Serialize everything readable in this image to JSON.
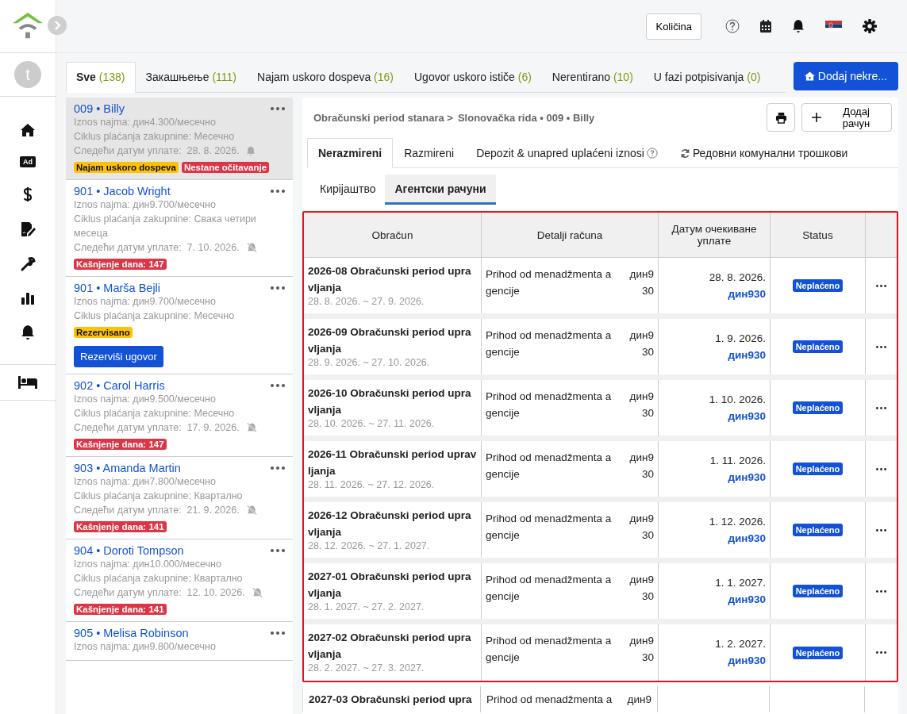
{
  "header": {
    "quantity_button": "Količina"
  },
  "avatar": {
    "letter": "t"
  },
  "rail": {
    "items": [
      {
        "kind": "home"
      },
      {
        "kind": "ad",
        "label": "Ad"
      },
      {
        "kind": "dollar"
      },
      {
        "kind": "contract"
      },
      {
        "kind": "wrench"
      },
      {
        "kind": "chart"
      },
      {
        "kind": "bell"
      },
      {
        "kind": "bed"
      }
    ]
  },
  "filter_tabs": [
    {
      "label": "Sve",
      "count": "(138)",
      "selected": true
    },
    {
      "label": "Закашњење",
      "count": "(111)",
      "selected": false
    },
    {
      "label": "Najam uskoro dospeva",
      "count": "(16)",
      "selected": false
    },
    {
      "label": "Ugovor uskoro ističe",
      "count": "(6)",
      "selected": false
    },
    {
      "label": "Nerentirano",
      "count": "(10)",
      "selected": false
    },
    {
      "label": "U fazi potpisivanja",
      "count": "(0)",
      "selected": false
    }
  ],
  "add_property_button": "Dodaj nekre...",
  "unit_separator": "•",
  "units": [
    {
      "number": "009",
      "name": "Billy",
      "rent": "Iznos najma: дин4.300/месечно",
      "cycle": "Ciklus plaćanja zakupnine: Месечно",
      "next_label": "Следећи датум уплате:",
      "next_date": "28. 8. 2026.",
      "reminder": true,
      "selected": true,
      "tags": [
        {
          "label": "Najam uskoro dospeva",
          "color": "#ffc107"
        },
        {
          "label": "Nestane očitavanje",
          "color": "#dc3545"
        }
      ]
    },
    {
      "number": "901",
      "name": "Jacob Wright",
      "rent": "Iznos najma: дин9.700/месечно",
      "cycle": "Ciklus plaćanja zakupnine: Свака четири месеца",
      "next_label": "Следећи датум уплате:",
      "next_date": "7. 10. 2026.",
      "reminder": false,
      "selected": false,
      "tags": [
        {
          "label": "Kašnjenje dana: 147",
          "color": "#dc3545"
        }
      ]
    },
    {
      "number": "901",
      "name": "Marša Bejli",
      "rent": "Iznos najma: дин9.700/месечно",
      "cycle": "Ciklus plaćanja zakupnine: Месечно",
      "selected": false,
      "tags": [
        {
          "label": "Rezervisano",
          "color": "#ffc107"
        }
      ],
      "button": "Rezerviši ugovor"
    },
    {
      "number": "902",
      "name": "Carol Harris",
      "rent": "Iznos najma: дин9.500/месечно",
      "cycle": "Ciklus plaćanja zakupnine: Месечно",
      "next_label": "Следећи датум уплате:",
      "next_date": "17. 9. 2026.",
      "reminder": false,
      "selected": false,
      "tags": [
        {
          "label": "Kašnjenje dana: 147",
          "color": "#dc3545"
        }
      ]
    },
    {
      "number": "903",
      "name": "Amanda Martin",
      "rent": "Iznos najma: дин7.800/месечно",
      "cycle": "Ciklus plaćanja zakupnine: Квартално",
      "next_label": "Следећи датум уплате:",
      "next_date": "21. 9. 2026.",
      "reminder": false,
      "selected": false,
      "tags": [
        {
          "label": "Kašnjenje dana: 141",
          "color": "#dc3545"
        }
      ]
    },
    {
      "number": "904",
      "name": "Doroti Tompson",
      "rent": "Iznos najma: дин10.000/месечно",
      "cycle": "Ciklus plaćanja zakupnine: Квартално",
      "next_label": "Следећи датум уплате:",
      "next_date": "12. 10. 2026.",
      "reminder": false,
      "selected": false,
      "tags": [
        {
          "label": "Kašnjenje dana: 141",
          "color": "#dc3545"
        }
      ]
    },
    {
      "number": "905",
      "name": "Melisa Robinson",
      "rent": "Iznos najma: дин9.800/месечно",
      "selected": false
    }
  ],
  "breadcrumb": [
    "Obračunski period stanara >",
    "Slonovačka rida • 009 • Billy"
  ],
  "add_bill_button": "Додај рачун",
  "detail_tabs": [
    {
      "label": "Nerazmireni",
      "kind": "plain",
      "selected": true
    },
    {
      "label": "Razmireni",
      "kind": "plain",
      "selected": false
    },
    {
      "label": "Depozit & unapred uplaćeni iznosi",
      "kind": "help",
      "selected": false
    },
    {
      "label": "Редовни комунални трошкови",
      "kind": "refresh",
      "selected": false
    }
  ],
  "sub_tabs": [
    {
      "label": "Кирijaштво",
      "selected": false
    },
    {
      "label": "Агентски рачуни",
      "selected": true
    }
  ],
  "table": {
    "columns": [
      "Obračun",
      "Detalji računa",
      "Датум очекиване уплате",
      "Status"
    ],
    "rows": [
      {
        "title": "2026-08 Obračunski period upravljanja",
        "range": "28. 8. 2026. ~ 27. 9. 2026.",
        "detail": "Prihod od menadžmenta agencije",
        "amount": "дин930",
        "date": "28. 8. 2026.",
        "due": "дин930",
        "status": "Neplaćeno"
      },
      {
        "title": "2026-09 Obračunski period upravljanja",
        "range": "28. 9. 2026. ~ 27. 10. 2026.",
        "detail": "Prihod od menadžmenta agencije",
        "amount": "дин930",
        "date": "1. 9. 2026.",
        "due": "дин930",
        "status": "Neplaćeno"
      },
      {
        "title": "2026-10 Obračunski period upravljanja",
        "range": "28. 10. 2026. ~ 27. 11. 2026.",
        "detail": "Prihod od menadžmenta agencije",
        "amount": "дин930",
        "date": "1. 10. 2026.",
        "due": "дин930",
        "status": "Neplaćeno"
      },
      {
        "title": "2026-11 Obračunski period upravljanja",
        "range": "28. 11. 2026. ~ 27. 12. 2026.",
        "detail": "Prihod od menadžmenta agencije",
        "amount": "дин930",
        "date": "1. 11. 2026.",
        "due": "дин930",
        "status": "Neplaćeno"
      },
      {
        "title": "2026-12 Obračunski period upravljanja",
        "range": "28. 12. 2026. ~ 27. 1. 2027.",
        "detail": "Prihod od menadžmenta agencije",
        "amount": "дин930",
        "date": "1. 12. 2026.",
        "due": "дин930",
        "status": "Neplaćeno"
      },
      {
        "title": "2027-01 Obračunski period upravljanja",
        "range": "28. 1. 2027. ~ 27. 2. 2027.",
        "detail": "Prihod od menadžmenta agencije",
        "amount": "дин930",
        "date": "1. 1. 2027.",
        "due": "дин930",
        "status": "Neplaćeno"
      },
      {
        "title": "2027-02 Obračunski period upravljanja",
        "range": "28. 2. 2027. ~ 27. 3. 2027.",
        "detail": "Prihod od menadžmenta agencije",
        "amount": "дин930",
        "date": "1. 2. 2027.",
        "due": "дин930",
        "status": "Neplaćeno"
      }
    ],
    "partial_row": {
      "title": "2027-03 Obračunski period upra",
      "detail": "Prihod od menadžmenta a",
      "amount": "дин9"
    }
  }
}
